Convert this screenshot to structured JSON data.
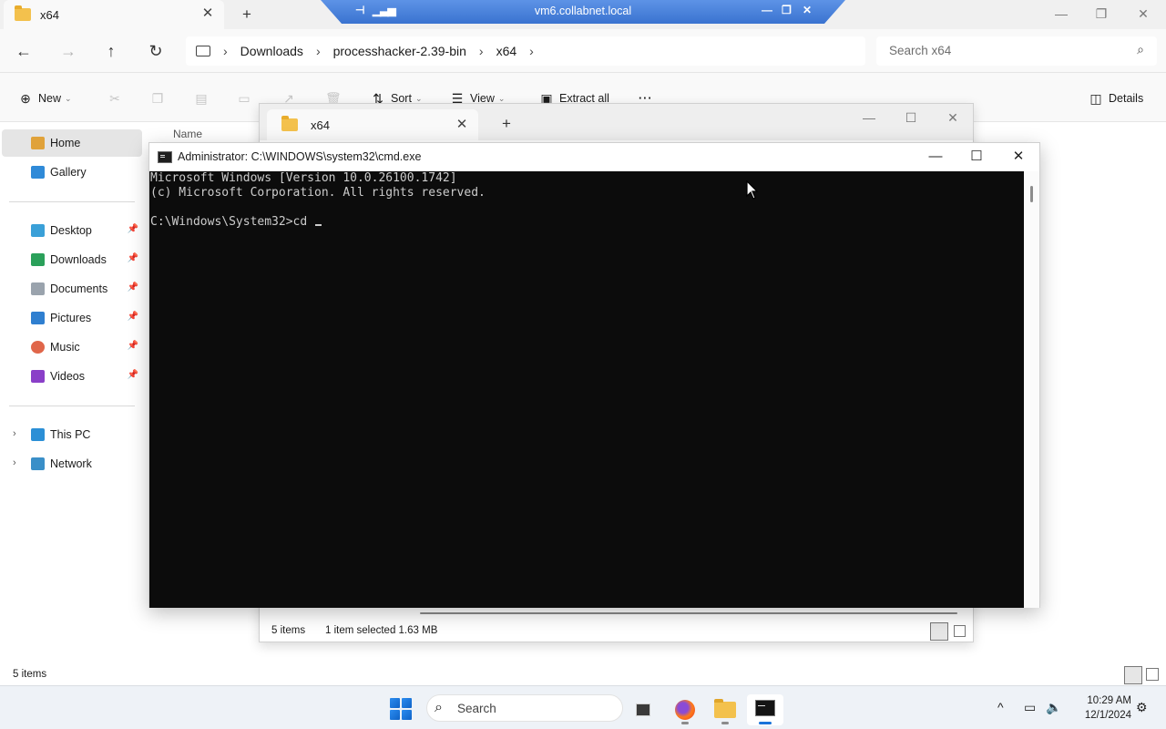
{
  "explorer": {
    "tab_title": "x64",
    "breadcrumb": [
      "Downloads",
      "processhacker-2.39-bin",
      "x64"
    ],
    "search_placeholder": "Search x64",
    "toolbar": {
      "new": "New",
      "sort": "Sort",
      "view": "View",
      "extract_all": "Extract all",
      "more": "···",
      "details": "Details"
    },
    "sidebar": {
      "top": [
        {
          "label": "Home",
          "icon": "home-icon",
          "selected": true
        },
        {
          "label": "Gallery",
          "icon": "gallery-icon"
        }
      ],
      "pinned": [
        {
          "label": "Desktop",
          "icon": "desktop-icon"
        },
        {
          "label": "Downloads",
          "icon": "downloads-icon"
        },
        {
          "label": "Documents",
          "icon": "documents-icon"
        },
        {
          "label": "Pictures",
          "icon": "pictures-icon"
        },
        {
          "label": "Music",
          "icon": "music-icon"
        },
        {
          "label": "Videos",
          "icon": "videos-icon"
        }
      ],
      "bottom": [
        {
          "label": "This PC",
          "icon": "this-pc-icon"
        },
        {
          "label": "Network",
          "icon": "network-icon"
        }
      ]
    },
    "column_name": "Name",
    "status_items": "5 items"
  },
  "explorer2": {
    "tab_title": "x64",
    "status_items": "5 items",
    "status_selected": "1 item selected  1.63 MB"
  },
  "cmd": {
    "title": "Administrator: C:\\WINDOWS\\system32\\cmd.exe",
    "lines": [
      "Microsoft Windows [Version 10.0.26100.1742]",
      "(c) Microsoft Corporation. All rights reserved.",
      "",
      "C:\\Windows\\System32>cd "
    ]
  },
  "rdp": {
    "host": "vm6.collabnet.local"
  },
  "taskbar": {
    "search": "Search",
    "apps": [
      "task-view-icon",
      "firefox-icon",
      "file-explorer-icon",
      "command-prompt-icon"
    ],
    "time": "10:29 AM",
    "date": "12/1/2024"
  },
  "colors": {
    "accent": "#1a73d9",
    "console_bg": "#0c0c0c",
    "console_fg": "#cccccc",
    "rdp_bar": "#3a73d0"
  }
}
